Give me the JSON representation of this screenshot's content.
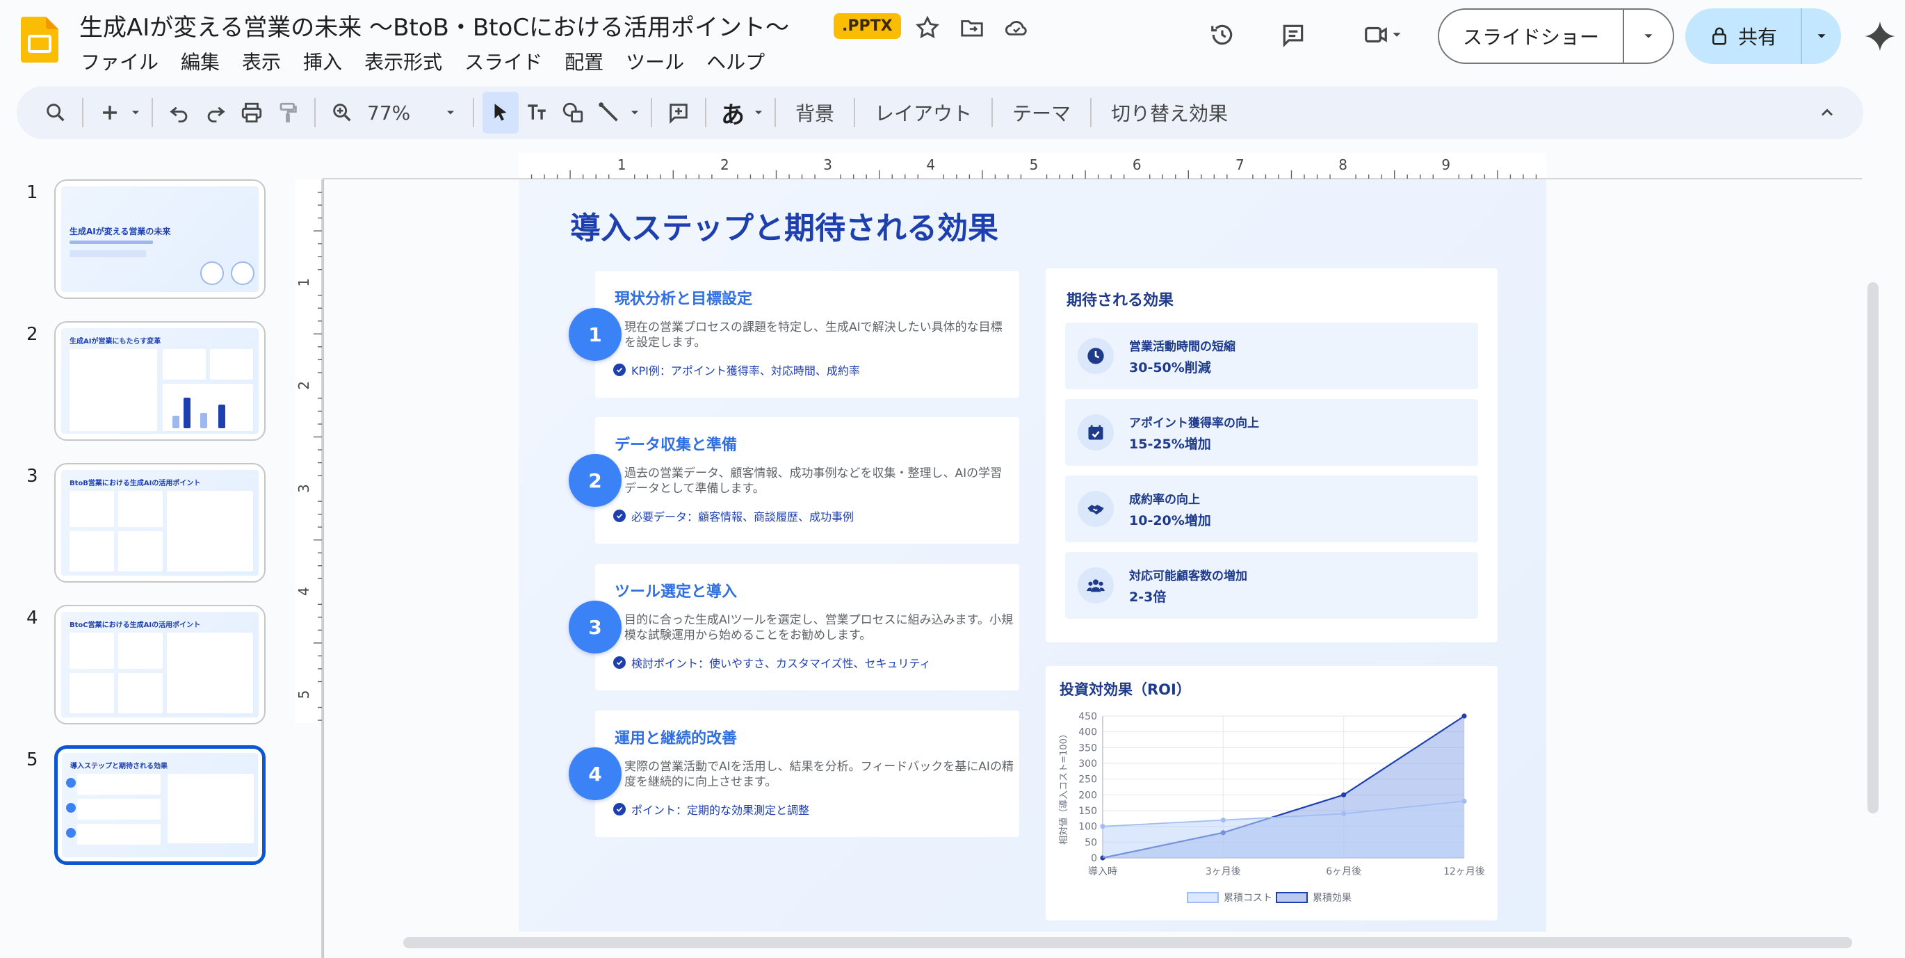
{
  "app": {
    "title": "生成AIが変える営業の未来 〜BtoB・BtoCにおける活用ポイント〜",
    "file_badge": ".PPTX",
    "slideshow_label": "スライドショー",
    "share_label": "共有"
  },
  "menu": [
    "ファイル",
    "編集",
    "表示",
    "挿入",
    "表示形式",
    "スライド",
    "配置",
    "ツール",
    "ヘルプ"
  ],
  "toolbar": {
    "zoom": "77%",
    "input_tool": "あ",
    "text_buttons": [
      "背景",
      "レイアウト",
      "テーマ",
      "切り替え効果"
    ]
  },
  "ruler": {
    "h_numbers": [
      "1",
      "2",
      "3",
      "4",
      "5",
      "6",
      "7",
      "8",
      "9"
    ],
    "v_numbers": [
      "1",
      "2",
      "3",
      "4",
      "5"
    ]
  },
  "filmstrip": {
    "numbers": [
      "1",
      "2",
      "3",
      "4",
      "5"
    ],
    "titles": [
      "生成AIが変える営業の未来",
      "生成AIが営業にもたらす変革",
      "BtoB営業における生成AIの活用ポイント",
      "BtoC営業における生成AIの活用ポイント",
      "導入ステップと期待される効果"
    ],
    "active_index": 4
  },
  "slide": {
    "title": "導入ステップと期待される効果",
    "steps": [
      {
        "num": "1",
        "title": "現状分析と目標設定",
        "desc": "現在の営業プロセスの課題を特定し、生成AIで解決したい具体的な目標を設定します。",
        "note": "KPI例：アポイント獲得率、対応時間、成約率"
      },
      {
        "num": "2",
        "title": "データ収集と準備",
        "desc": "過去の営業データ、顧客情報、成功事例などを収集・整理し、AIの学習データとして準備します。",
        "note": "必要データ：顧客情報、商談履歴、成功事例"
      },
      {
        "num": "3",
        "title": "ツール選定と導入",
        "desc": "目的に合った生成AIツールを選定し、営業プロセスに組み込みます。小規模な試験運用から始めることをお勧めします。",
        "note": "検討ポイント：使いやすさ、カスタマイズ性、セキュリティ"
      },
      {
        "num": "4",
        "title": "運用と継続的改善",
        "desc": "実際の営業活動でAIを活用し、結果を分析。フィードバックを基にAIの精度を継続的に向上させます。",
        "note": "ポイント：定期的な効果測定と調整"
      }
    ],
    "effects": {
      "title": "期待される効果",
      "items": [
        {
          "icon": "clock-icon",
          "label": "営業活動時間の短縮",
          "value": "30-50%削減"
        },
        {
          "icon": "calendar-check-icon",
          "label": "アポイント獲得率の向上",
          "value": "15-25%増加"
        },
        {
          "icon": "handshake-icon",
          "label": "成約率の向上",
          "value": "10-20%増加"
        },
        {
          "icon": "users-icon",
          "label": "対応可能顧客数の増加",
          "value": "2-3倍"
        }
      ]
    },
    "roi_title": "投資対効果（ROI）"
  },
  "chart_data": {
    "type": "area",
    "title": "投資対効果（ROI）",
    "ylabel": "相対値（導入コスト=100）",
    "xlabel": "",
    "categories": [
      "導入時",
      "3ヶ月後",
      "6ヶ月後",
      "12ヶ月後"
    ],
    "ylim": [
      0,
      450
    ],
    "yticks": [
      0,
      50,
      100,
      150,
      200,
      250,
      300,
      350,
      400,
      450
    ],
    "grid": true,
    "legend": "bottom",
    "series": [
      {
        "name": "累積コスト",
        "values": [
          100,
          120,
          140,
          180
        ],
        "color": "#9fbdf3"
      },
      {
        "name": "累積効果",
        "values": [
          0,
          80,
          200,
          450
        ],
        "color": "#1e40af"
      }
    ]
  },
  "colors": {
    "accent": "#0b57d0",
    "slide_title": "#1e40af",
    "step_circle": "#3b82f6",
    "share_bg": "#c2e7ff"
  }
}
